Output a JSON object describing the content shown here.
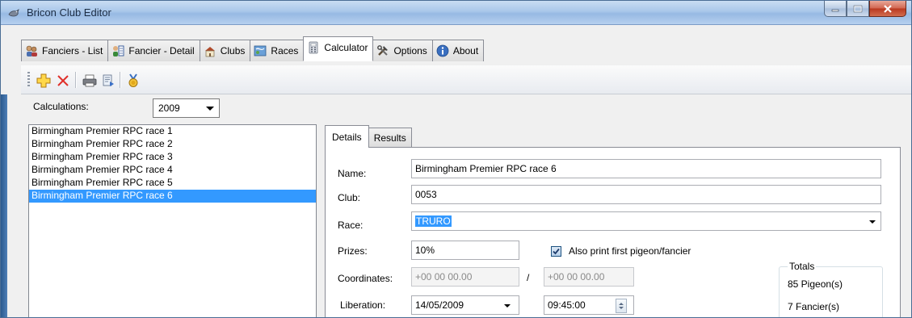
{
  "window": {
    "title": "Bricon Club Editor"
  },
  "tabs": [
    {
      "label": "Fanciers - List",
      "icon": "fanciers-list-icon"
    },
    {
      "label": "Fancier - Detail",
      "icon": "fancier-detail-icon"
    },
    {
      "label": "Clubs",
      "icon": "clubs-icon"
    },
    {
      "label": "Races",
      "icon": "races-icon"
    },
    {
      "label": "Calculator",
      "icon": "calculator-icon",
      "active": true
    },
    {
      "label": "Options",
      "icon": "tools-icon"
    },
    {
      "label": "About",
      "icon": "info-icon"
    }
  ],
  "toolbar": {
    "buttons": [
      "add-icon",
      "delete-icon",
      "print-icon",
      "export-icon",
      "medal-icon"
    ]
  },
  "calculations": {
    "label": "Calculations:",
    "year": "2009"
  },
  "race_list": [
    "Birmingham Premier RPC race 1",
    "Birmingham Premier RPC race 2",
    "Birmingham Premier RPC race 3",
    "Birmingham Premier RPC race 4",
    "Birmingham Premier RPC race 5",
    "Birmingham Premier RPC race 6"
  ],
  "selected_race_index": 5,
  "detail_tabs": [
    "Details",
    "Results"
  ],
  "details": {
    "name_label": "Name:",
    "name_value": "Birmingham Premier RPC race 6",
    "club_label": "Club:",
    "club_value": "0053",
    "race_label": "Race:",
    "race_value": "TRURO",
    "prizes_label": "Prizes:",
    "prizes_value": "10%",
    "also_print_label": "Also print first pigeon/fancier",
    "also_print_checked": true,
    "coordinates_label": "Coordinates:",
    "coord1": "+00 00 00.00",
    "coord_separator": "/",
    "coord2": "+00 00 00.00",
    "liberation_label": "Liberation:",
    "liberation_date": "14/05/2009",
    "liberation_time": "09:45:00"
  },
  "totals": {
    "legend": "Totals",
    "pigeons": "85 Pigeon(s)",
    "fanciers": "7 Fancier(s)"
  },
  "colors": {
    "selection": "#3399ff",
    "titlebar": "#a9c7ea",
    "close_button": "#c8452b"
  }
}
